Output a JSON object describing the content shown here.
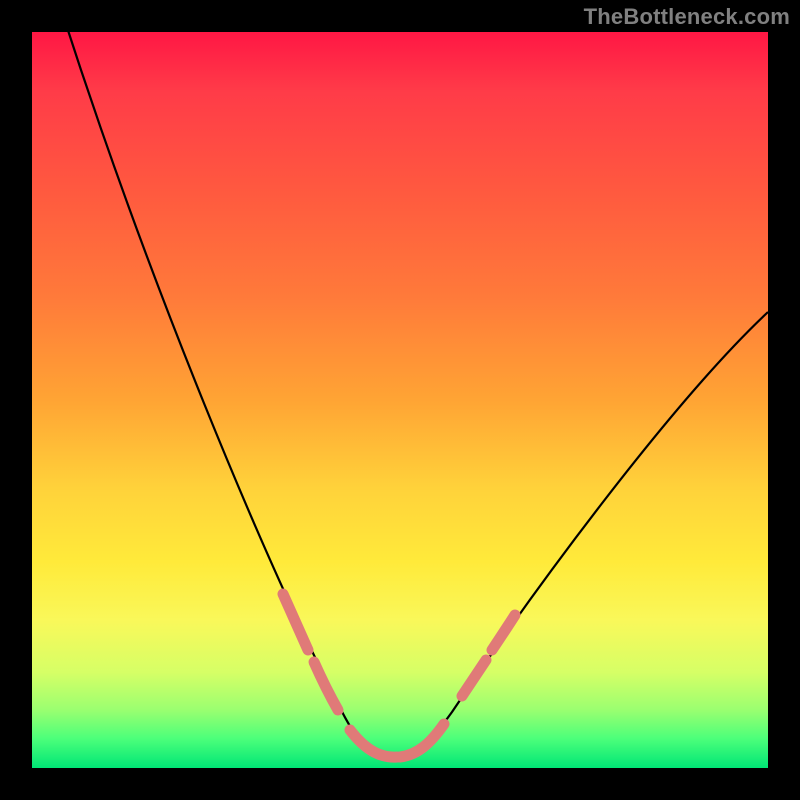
{
  "watermark": "TheBottleneck.com",
  "chart_data": {
    "type": "line",
    "title": "",
    "xlabel": "",
    "ylabel": "",
    "xlim": [
      0,
      100
    ],
    "ylim": [
      0,
      100
    ],
    "series": [
      {
        "name": "bottleneck-curve",
        "x": [
          4,
          8,
          12,
          16,
          20,
          24,
          28,
          32,
          36,
          38,
          40,
          42,
          44,
          46,
          48,
          50,
          54,
          58,
          62,
          66,
          70,
          74,
          78,
          82,
          86,
          90,
          94,
          98,
          100
        ],
        "y": [
          102,
          93,
          84,
          75,
          66,
          57,
          48,
          39,
          29,
          23,
          17,
          11,
          6,
          2,
          1,
          1,
          2,
          6,
          11,
          17,
          24,
          31,
          38,
          45,
          52,
          58,
          64,
          70,
          72
        ]
      }
    ],
    "highlight_segments": [
      {
        "x_from": 32,
        "x_to": 38,
        "side": "left"
      },
      {
        "x_from": 42,
        "x_to": 56,
        "side": "bottom"
      },
      {
        "x_from": 56,
        "x_to": 62,
        "side": "right"
      }
    ],
    "background_gradient": {
      "top": "#ff1744",
      "mid": "#ffea3a",
      "bottom": "#00e676"
    }
  }
}
